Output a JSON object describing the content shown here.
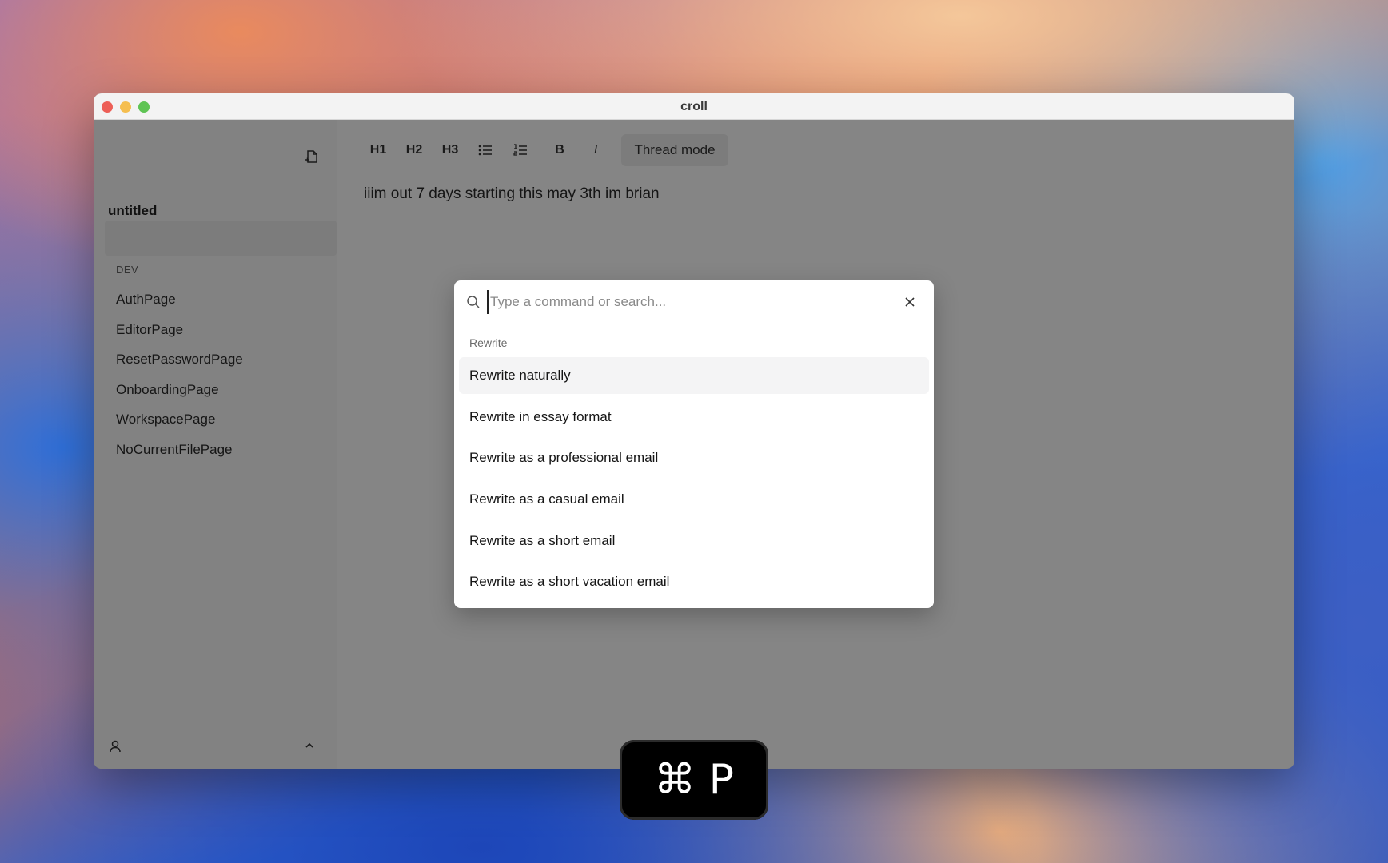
{
  "window": {
    "title": "croll"
  },
  "sidebar": {
    "current_file": "untitled",
    "group_title": "DEV",
    "items": [
      {
        "label": "AuthPage"
      },
      {
        "label": "EditorPage"
      },
      {
        "label": "ResetPasswordPage"
      },
      {
        "label": "OnboardingPage"
      },
      {
        "label": "WorkspacePage"
      },
      {
        "label": "NoCurrentFilePage"
      }
    ]
  },
  "toolbar": {
    "h1": "H1",
    "h2": "H2",
    "h3": "H3",
    "bold": "B",
    "italic": "I",
    "thread_mode": "Thread mode"
  },
  "editor": {
    "content": "iiim out 7 days starting this may 3th im brian"
  },
  "command_palette": {
    "placeholder": "Type a command or search...",
    "group_label": "Rewrite",
    "items": [
      {
        "label": "Rewrite naturally",
        "highlighted": true
      },
      {
        "label": "Rewrite in essay format",
        "highlighted": false
      },
      {
        "label": "Rewrite as a professional email",
        "highlighted": false
      },
      {
        "label": "Rewrite as a casual email",
        "highlighted": false
      },
      {
        "label": "Rewrite as a short email",
        "highlighted": false
      },
      {
        "label": "Rewrite as a short vacation email",
        "highlighted": false
      }
    ]
  },
  "shortcut_hud": {
    "keys": "⌘ P"
  }
}
